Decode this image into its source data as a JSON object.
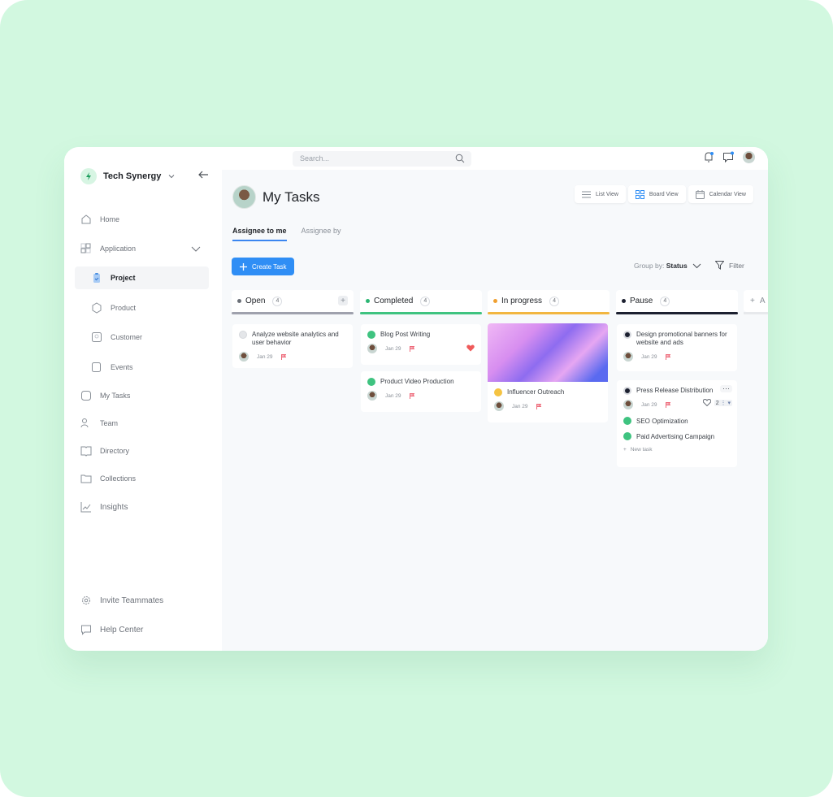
{
  "brand": {
    "name": "Tech Synergy",
    "accent": "#2bb673"
  },
  "search": {
    "placeholder": "Search..."
  },
  "sidebar": {
    "items": [
      {
        "label": "Home",
        "icon": "home-icon"
      },
      {
        "label": "Application",
        "icon": "apps-icon"
      },
      {
        "label": "Project",
        "icon": "clipboard-icon",
        "active": true
      },
      {
        "label": "Product",
        "icon": "box-icon"
      },
      {
        "label": "Customer",
        "icon": "user-card-icon"
      },
      {
        "label": "Events",
        "icon": "calendar-icon"
      },
      {
        "label": "My Tasks",
        "icon": "task-icon"
      },
      {
        "label": "Team",
        "icon": "team-icon"
      },
      {
        "label": "Directory",
        "icon": "book-icon"
      },
      {
        "label": "Collections",
        "icon": "folder-icon"
      },
      {
        "label": "Insights",
        "icon": "chart-icon"
      }
    ],
    "footer": [
      {
        "label": "Invite Teammates",
        "icon": "gear-icon"
      },
      {
        "label": "Help Center",
        "icon": "help-chat-icon"
      }
    ]
  },
  "header": {
    "title": "My Tasks",
    "views": [
      {
        "label": "List View",
        "icon": "list-icon"
      },
      {
        "label": "Board View",
        "icon": "board-icon",
        "active": true
      },
      {
        "label": "Calendar View",
        "icon": "calendar-icon"
      }
    ],
    "tabs": [
      {
        "label": "Assignee to me",
        "active": true
      },
      {
        "label": "Assignee by"
      }
    ]
  },
  "toolbar": {
    "create_label": "Create Task",
    "groupby_label": "Group by:",
    "groupby_value": "Status",
    "filter_label": "Filter"
  },
  "columns": [
    {
      "name": "Open",
      "count": "4",
      "color": "#9fa1ad",
      "dot": "#6b7078",
      "cards": [
        {
          "title": "Analyze website analytics and user behavior",
          "date": "Jan 29",
          "status": "open"
        }
      ]
    },
    {
      "name": "Completed",
      "count": "4",
      "color": "#3fc380",
      "dot": "#2bb673",
      "cards": [
        {
          "title": "Blog Post Writing",
          "date": "Jan 29",
          "status": "done",
          "liked": true
        },
        {
          "title": "Product Video Production",
          "date": "Jan 29",
          "status": "done"
        }
      ]
    },
    {
      "name": "In progress",
      "count": "4",
      "color": "#f2b640",
      "dot": "#f0a030",
      "cards": [
        {
          "title": "Influencer Outreach",
          "date": "Jan 29",
          "status": "progress",
          "has_image": true
        }
      ]
    },
    {
      "name": "Pause",
      "count": "4",
      "color": "#1c2030",
      "dot": "#1c2030",
      "cards": [
        {
          "title": "Design promotional banners for website and ads",
          "date": "Jan 29",
          "status": "pause"
        },
        {
          "title": "Press Release Distribution",
          "date": "Jan 29",
          "status": "pause",
          "subtask_count": "2",
          "subtasks": [
            "SEO Optimization",
            "Paid Advertising Campaign"
          ],
          "new_task_label": "New task"
        }
      ]
    }
  ],
  "add_column_label": "A"
}
